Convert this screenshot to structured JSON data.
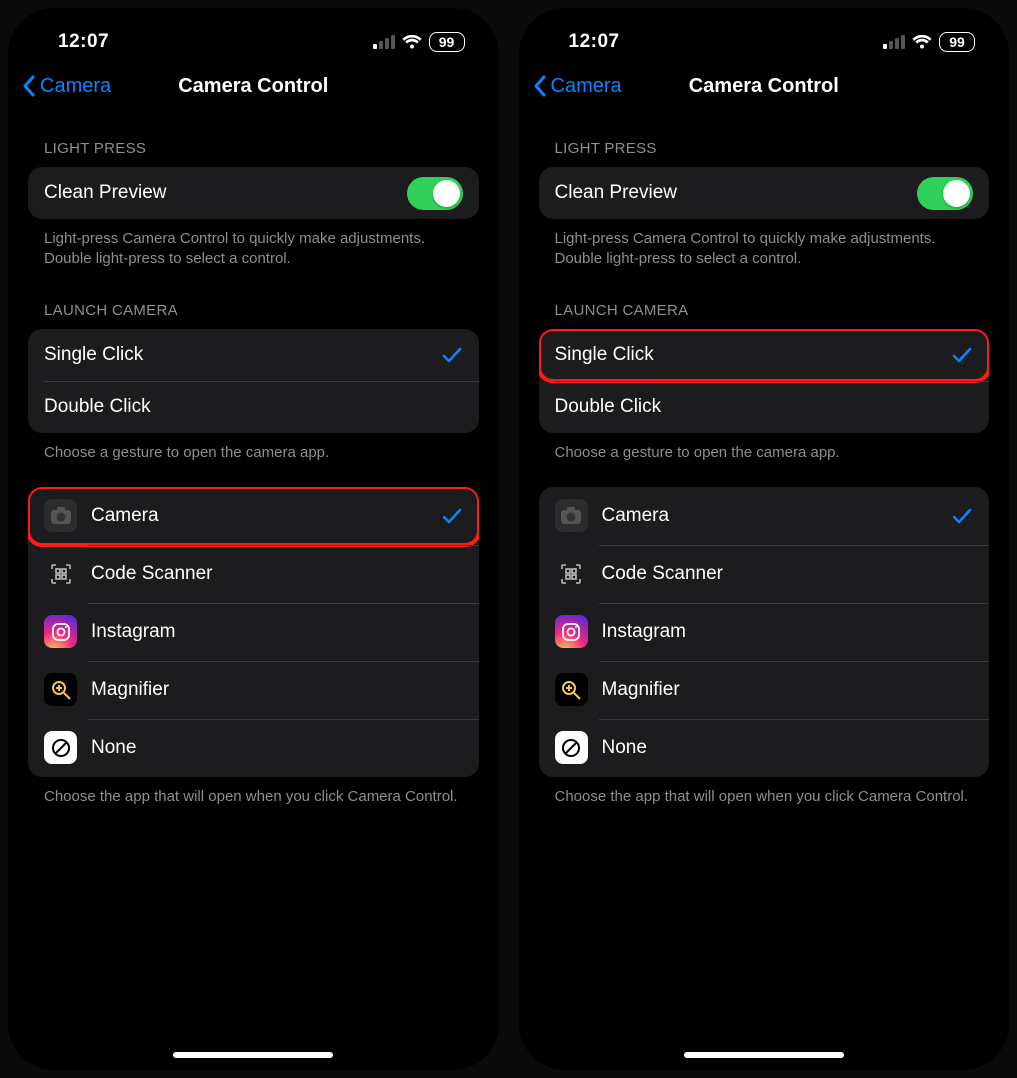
{
  "status": {
    "time": "12:07",
    "battery": "99"
  },
  "nav": {
    "back": "Camera",
    "title": "Camera Control"
  },
  "sections": {
    "light_press_header": "LIGHT PRESS",
    "clean_preview": "Clean Preview",
    "light_press_footer": "Light-press Camera Control to quickly make adjustments. Double light-press to select a control.",
    "launch_camera_header": "LAUNCH CAMERA",
    "single_click": "Single Click",
    "double_click": "Double Click",
    "gesture_footer": "Choose a gesture to open the camera app.",
    "apps": {
      "camera": "Camera",
      "code_scanner": "Code Scanner",
      "instagram": "Instagram",
      "magnifier": "Magnifier",
      "none": "None"
    },
    "app_footer": "Choose the app that will open when you click Camera Control."
  },
  "panes": [
    {
      "highlight": "camera_row"
    },
    {
      "highlight": "single_click_row"
    }
  ]
}
